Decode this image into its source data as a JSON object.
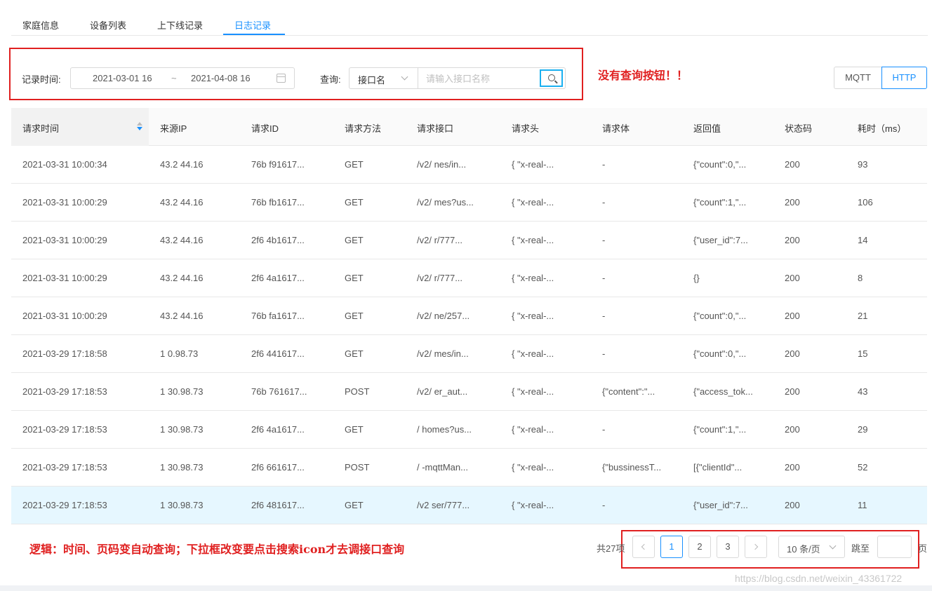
{
  "tabs": [
    {
      "label": "家庭信息"
    },
    {
      "label": "设备列表"
    },
    {
      "label": "上下线记录"
    },
    {
      "label": "日志记录",
      "active": true
    }
  ],
  "filter": {
    "time_label": "记录时间:",
    "date_start": "2021-03-01 16",
    "date_sep": "~",
    "date_end": "2021-04-08 16",
    "query_label": "查询:",
    "query_select": "接口名",
    "query_placeholder": "请输入接口名称",
    "query_value": ""
  },
  "annotation_top": "没有查询按钮！！",
  "protocol": {
    "mqtt": "MQTT",
    "http": "HTTP",
    "selected": "HTTP"
  },
  "table": {
    "columns": [
      "请求时间",
      "来源IP",
      "请求ID",
      "请求方法",
      "请求接口",
      "请求头",
      "请求体",
      "返回值",
      "状态码",
      "耗时（ms）"
    ],
    "rows": [
      [
        "2021-03-31 10:00:34",
        "43.2   44.16",
        "76b   f91617...",
        "GET",
        "/v2/   nes/in...",
        "{ \"x-real-...",
        "-",
        "{\"count\":0,\"...",
        "200",
        "93"
      ],
      [
        "2021-03-31 10:00:29",
        "43.2   44.16",
        "76b   fb1617...",
        "GET",
        "/v2/   mes?us...",
        "{ \"x-real-...",
        "-",
        "{\"count\":1,\"...",
        "200",
        "106"
      ],
      [
        "2021-03-31 10:00:29",
        "43.2   44.16",
        "2f6   4b1617...",
        "GET",
        "/v2/   r/777...",
        "{ \"x-real-...",
        "-",
        "{\"user_id\":7...",
        "200",
        "14"
      ],
      [
        "2021-03-31 10:00:29",
        "43.2   44.16",
        "2f6   4a1617...",
        "GET",
        "/v2/   r/777...",
        "{ \"x-real-...",
        "-",
        "{}",
        "200",
        "8"
      ],
      [
        "2021-03-31 10:00:29",
        "43.2   44.16",
        "76b   fa1617...",
        "GET",
        "/v2/   ne/257...",
        "{ \"x-real-...",
        "-",
        "{\"count\":0,\"...",
        "200",
        "21"
      ],
      [
        "2021-03-29 17:18:58",
        "1   0.98.73",
        "2f6   441617...",
        "GET",
        "/v2/   mes/in...",
        "{ \"x-real-...",
        "-",
        "{\"count\":0,\"...",
        "200",
        "15"
      ],
      [
        "2021-03-29 17:18:53",
        "1   30.98.73",
        "76b   761617...",
        "POST",
        "/v2/   er_aut...",
        "{ \"x-real-...",
        "{\"content\":\"...",
        "{\"access_tok...",
        "200",
        "43"
      ],
      [
        "2021-03-29 17:18:53",
        "1   30.98.73",
        "2f6   4a1617...",
        "GET",
        "/   homes?us...",
        "{ \"x-real-...",
        "-",
        "{\"count\":1,\"...",
        "200",
        "29"
      ],
      [
        "2021-03-29 17:18:53",
        "1   30.98.73",
        "2f6   661617...",
        "POST",
        "/   -mqttMan...",
        "{ \"x-real-...",
        "{\"bussinessT...",
        "[{\"clientId\"...",
        "200",
        "52"
      ],
      [
        "2021-03-29 17:18:53",
        "1   30.98.73",
        "2f6   481617...",
        "GET",
        "/v2   ser/777...",
        "{ \"x-real-...",
        "-",
        "{\"user_id\":7...",
        "200",
        "11"
      ]
    ]
  },
  "annotation_bottom": "逻辑：时间、页码变自动查询；下拉框改变要点击搜索icon才去调接口查询",
  "pagination": {
    "total": "共27项",
    "pages": [
      "1",
      "2",
      "3"
    ],
    "current": "1",
    "page_size": "10 条/页",
    "jump_label": "跳至",
    "page_suffix": "页"
  },
  "watermark": "https://blog.csdn.net/weixin_43361722"
}
